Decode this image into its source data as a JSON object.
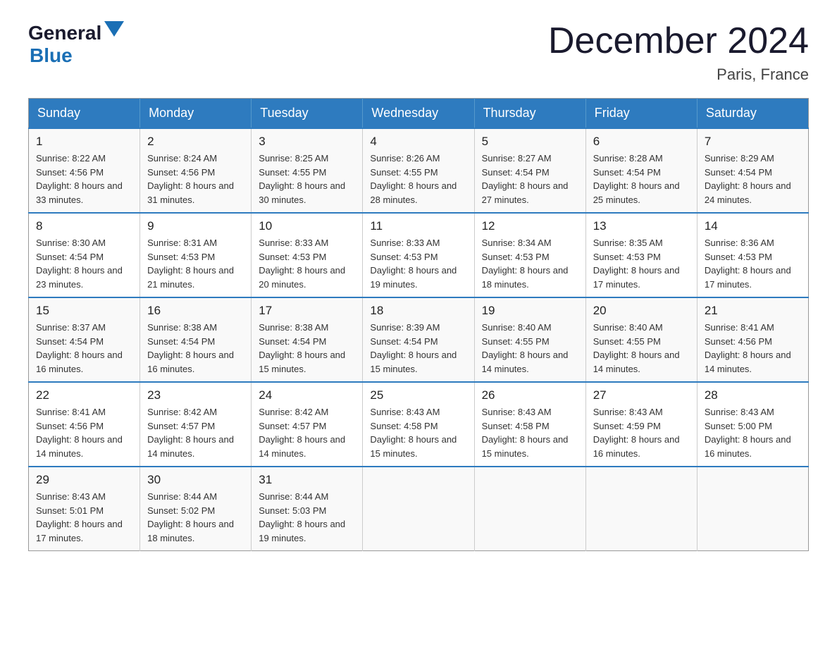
{
  "logo": {
    "general": "General",
    "arrow": "▲",
    "blue": "Blue"
  },
  "title": "December 2024",
  "location": "Paris, France",
  "days_of_week": [
    "Sunday",
    "Monday",
    "Tuesday",
    "Wednesday",
    "Thursday",
    "Friday",
    "Saturday"
  ],
  "weeks": [
    [
      {
        "day": "1",
        "sunrise": "8:22 AM",
        "sunset": "4:56 PM",
        "daylight": "8 hours and 33 minutes."
      },
      {
        "day": "2",
        "sunrise": "8:24 AM",
        "sunset": "4:56 PM",
        "daylight": "8 hours and 31 minutes."
      },
      {
        "day": "3",
        "sunrise": "8:25 AM",
        "sunset": "4:55 PM",
        "daylight": "8 hours and 30 minutes."
      },
      {
        "day": "4",
        "sunrise": "8:26 AM",
        "sunset": "4:55 PM",
        "daylight": "8 hours and 28 minutes."
      },
      {
        "day": "5",
        "sunrise": "8:27 AM",
        "sunset": "4:54 PM",
        "daylight": "8 hours and 27 minutes."
      },
      {
        "day": "6",
        "sunrise": "8:28 AM",
        "sunset": "4:54 PM",
        "daylight": "8 hours and 25 minutes."
      },
      {
        "day": "7",
        "sunrise": "8:29 AM",
        "sunset": "4:54 PM",
        "daylight": "8 hours and 24 minutes."
      }
    ],
    [
      {
        "day": "8",
        "sunrise": "8:30 AM",
        "sunset": "4:54 PM",
        "daylight": "8 hours and 23 minutes."
      },
      {
        "day": "9",
        "sunrise": "8:31 AM",
        "sunset": "4:53 PM",
        "daylight": "8 hours and 21 minutes."
      },
      {
        "day": "10",
        "sunrise": "8:33 AM",
        "sunset": "4:53 PM",
        "daylight": "8 hours and 20 minutes."
      },
      {
        "day": "11",
        "sunrise": "8:33 AM",
        "sunset": "4:53 PM",
        "daylight": "8 hours and 19 minutes."
      },
      {
        "day": "12",
        "sunrise": "8:34 AM",
        "sunset": "4:53 PM",
        "daylight": "8 hours and 18 minutes."
      },
      {
        "day": "13",
        "sunrise": "8:35 AM",
        "sunset": "4:53 PM",
        "daylight": "8 hours and 17 minutes."
      },
      {
        "day": "14",
        "sunrise": "8:36 AM",
        "sunset": "4:53 PM",
        "daylight": "8 hours and 17 minutes."
      }
    ],
    [
      {
        "day": "15",
        "sunrise": "8:37 AM",
        "sunset": "4:54 PM",
        "daylight": "8 hours and 16 minutes."
      },
      {
        "day": "16",
        "sunrise": "8:38 AM",
        "sunset": "4:54 PM",
        "daylight": "8 hours and 16 minutes."
      },
      {
        "day": "17",
        "sunrise": "8:38 AM",
        "sunset": "4:54 PM",
        "daylight": "8 hours and 15 minutes."
      },
      {
        "day": "18",
        "sunrise": "8:39 AM",
        "sunset": "4:54 PM",
        "daylight": "8 hours and 15 minutes."
      },
      {
        "day": "19",
        "sunrise": "8:40 AM",
        "sunset": "4:55 PM",
        "daylight": "8 hours and 14 minutes."
      },
      {
        "day": "20",
        "sunrise": "8:40 AM",
        "sunset": "4:55 PM",
        "daylight": "8 hours and 14 minutes."
      },
      {
        "day": "21",
        "sunrise": "8:41 AM",
        "sunset": "4:56 PM",
        "daylight": "8 hours and 14 minutes."
      }
    ],
    [
      {
        "day": "22",
        "sunrise": "8:41 AM",
        "sunset": "4:56 PM",
        "daylight": "8 hours and 14 minutes."
      },
      {
        "day": "23",
        "sunrise": "8:42 AM",
        "sunset": "4:57 PM",
        "daylight": "8 hours and 14 minutes."
      },
      {
        "day": "24",
        "sunrise": "8:42 AM",
        "sunset": "4:57 PM",
        "daylight": "8 hours and 14 minutes."
      },
      {
        "day": "25",
        "sunrise": "8:43 AM",
        "sunset": "4:58 PM",
        "daylight": "8 hours and 15 minutes."
      },
      {
        "day": "26",
        "sunrise": "8:43 AM",
        "sunset": "4:58 PM",
        "daylight": "8 hours and 15 minutes."
      },
      {
        "day": "27",
        "sunrise": "8:43 AM",
        "sunset": "4:59 PM",
        "daylight": "8 hours and 16 minutes."
      },
      {
        "day": "28",
        "sunrise": "8:43 AM",
        "sunset": "5:00 PM",
        "daylight": "8 hours and 16 minutes."
      }
    ],
    [
      {
        "day": "29",
        "sunrise": "8:43 AM",
        "sunset": "5:01 PM",
        "daylight": "8 hours and 17 minutes."
      },
      {
        "day": "30",
        "sunrise": "8:44 AM",
        "sunset": "5:02 PM",
        "daylight": "8 hours and 18 minutes."
      },
      {
        "day": "31",
        "sunrise": "8:44 AM",
        "sunset": "5:03 PM",
        "daylight": "8 hours and 19 minutes."
      },
      null,
      null,
      null,
      null
    ]
  ],
  "labels": {
    "sunrise": "Sunrise:",
    "sunset": "Sunset:",
    "daylight": "Daylight:"
  }
}
